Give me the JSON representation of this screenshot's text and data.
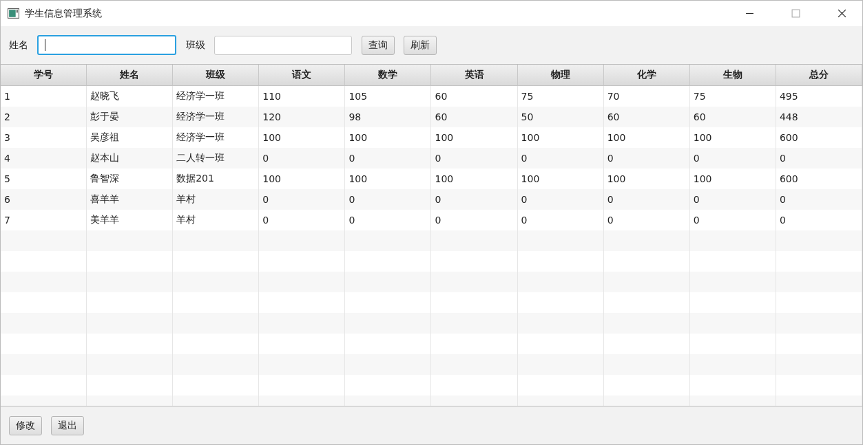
{
  "window": {
    "title": "学生信息管理系统"
  },
  "search": {
    "name_label": "姓名",
    "name_field": {
      "focused": true
    },
    "class_label": "班级",
    "class_field": {
      "focused": false
    },
    "buttons": [
      "查询",
      "刷新"
    ]
  },
  "table": {
    "columns": [
      "学号",
      "姓名",
      "班级",
      "语文",
      "数学",
      "英语",
      "物理",
      "化学",
      "生物",
      "总分"
    ],
    "rows": [
      [
        "1",
        "赵晓飞",
        "经济学一班",
        "110",
        "105",
        "60",
        "75",
        "70",
        "75",
        "495"
      ],
      [
        "2",
        "彭于晏",
        "经济学一班",
        "120",
        "98",
        "60",
        "50",
        "60",
        "60",
        "448"
      ],
      [
        "3",
        "吴彦祖",
        "经济学一班",
        "100",
        "100",
        "100",
        "100",
        "100",
        "100",
        "600"
      ],
      [
        "4",
        "赵本山",
        "二人转一班",
        "0",
        "0",
        "0",
        "0",
        "0",
        "0",
        "0"
      ],
      [
        "5",
        "鲁智深",
        "数据201",
        "100",
        "100",
        "100",
        "100",
        "100",
        "100",
        "600"
      ],
      [
        "6",
        "喜羊羊",
        "羊村",
        "0",
        "0",
        "0",
        "0",
        "0",
        "0",
        "0"
      ],
      [
        "7",
        "美羊羊",
        "羊村",
        "0",
        "0",
        "0",
        "0",
        "0",
        "0",
        "0"
      ]
    ]
  },
  "footer": {
    "buttons": [
      "修改",
      "退出"
    ]
  }
}
